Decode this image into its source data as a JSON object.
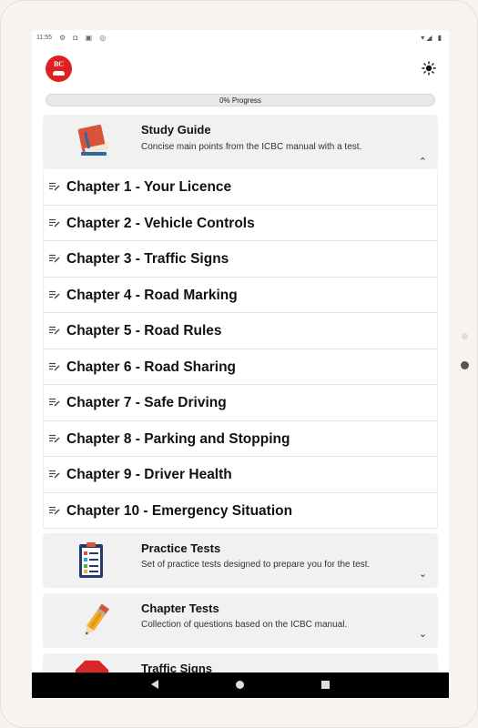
{
  "status": {
    "time": "11:55",
    "left_icons": "⚙ ◘ ▣ ◎",
    "right_icons": "▾◢ ▮"
  },
  "header": {
    "logo_text": "BC",
    "theme_icon": "sun-icon"
  },
  "progress": {
    "label": "0% Progress",
    "value": 0
  },
  "study_guide": {
    "title": "Study Guide",
    "description": "Concise main points from the ICBC manual with a test.",
    "expanded": true,
    "chapters": [
      "Chapter 1 - Your Licence",
      "Chapter 2 - Vehicle Controls",
      "Chapter 3 - Traffic Signs",
      "Chapter 4 - Road Marking",
      "Chapter 5 - Road Rules",
      "Chapter 6 - Road Sharing",
      "Chapter 7 - Safe Driving",
      "Chapter 8 - Parking and Stopping",
      "Chapter 9 - Driver Health",
      "Chapter 10 - Emergency Situation"
    ]
  },
  "practice_tests": {
    "title": "Practice Tests",
    "description": "Set of practice tests designed to prepare you for the test."
  },
  "chapter_tests": {
    "title": "Chapter Tests",
    "description": "Collection of questions based on the ICBC manual."
  },
  "traffic_signs": {
    "title": "Traffic Signs"
  },
  "chevron_up": "⌃",
  "chevron_down": "⌄"
}
